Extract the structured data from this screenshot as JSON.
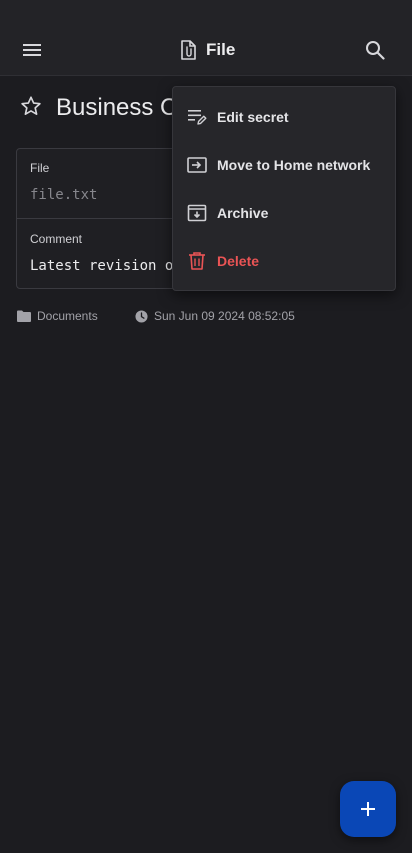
{
  "appbar": {
    "title": "File",
    "menu_icon": "hamburger-menu-icon",
    "title_icon": "file-attachment-icon",
    "search_icon": "search-icon"
  },
  "item": {
    "title": "Business C",
    "favorite_icon": "star-outline-icon"
  },
  "fields": {
    "file_label": "File",
    "file_value": "file.txt",
    "comment_label": "Comment",
    "comment_value": "Latest revision o"
  },
  "meta": {
    "folder": "Documents",
    "timestamp": "Sun Jun 09 2024 08:52:05"
  },
  "menu": {
    "items": [
      {
        "label": "Edit secret",
        "icon": "edit-list-icon"
      },
      {
        "label": "Move to Home network",
        "icon": "move-to-icon"
      },
      {
        "label": "Archive",
        "icon": "archive-icon"
      },
      {
        "label": "Delete",
        "icon": "trash-icon"
      }
    ]
  },
  "fab": {
    "icon": "plus-icon"
  },
  "colors": {
    "background": "#1c1c20",
    "danger": "#ea5455",
    "accent": "#0a47b6"
  }
}
